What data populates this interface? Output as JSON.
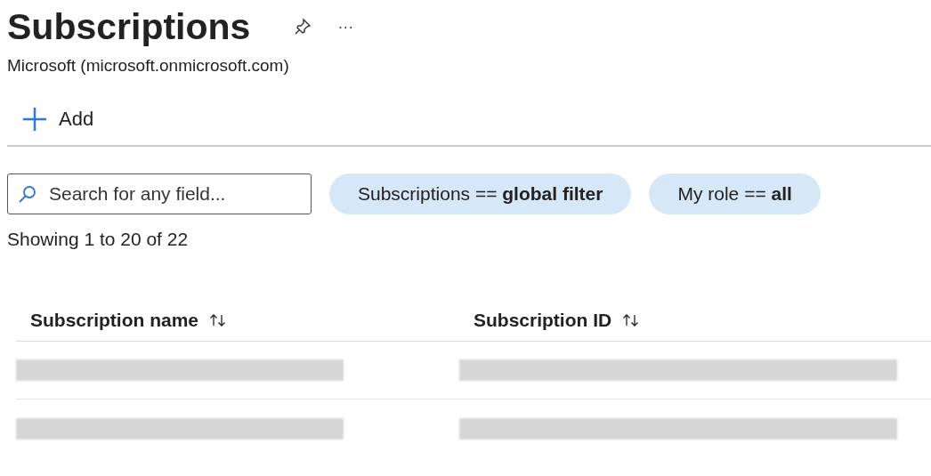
{
  "header": {
    "title": "Subscriptions",
    "subtitle": "Microsoft (microsoft.onmicrosoft.com)",
    "more": "···"
  },
  "toolbar": [
    {
      "label": "Add",
      "kind": "add"
    }
  ],
  "search": {
    "placeholder": "Search for any field..."
  },
  "filters": [
    "Subscriptions == **global filter**",
    "My role == **all**"
  ],
  "summary": "Showing 1 to 20 of 22",
  "table": {
    "columns": [
      "Subscription name",
      "Subscription ID"
    ],
    "rows": [
      {
        "kind": "redacted"
      },
      {
        "kind": "redacted"
      }
    ]
  }
}
